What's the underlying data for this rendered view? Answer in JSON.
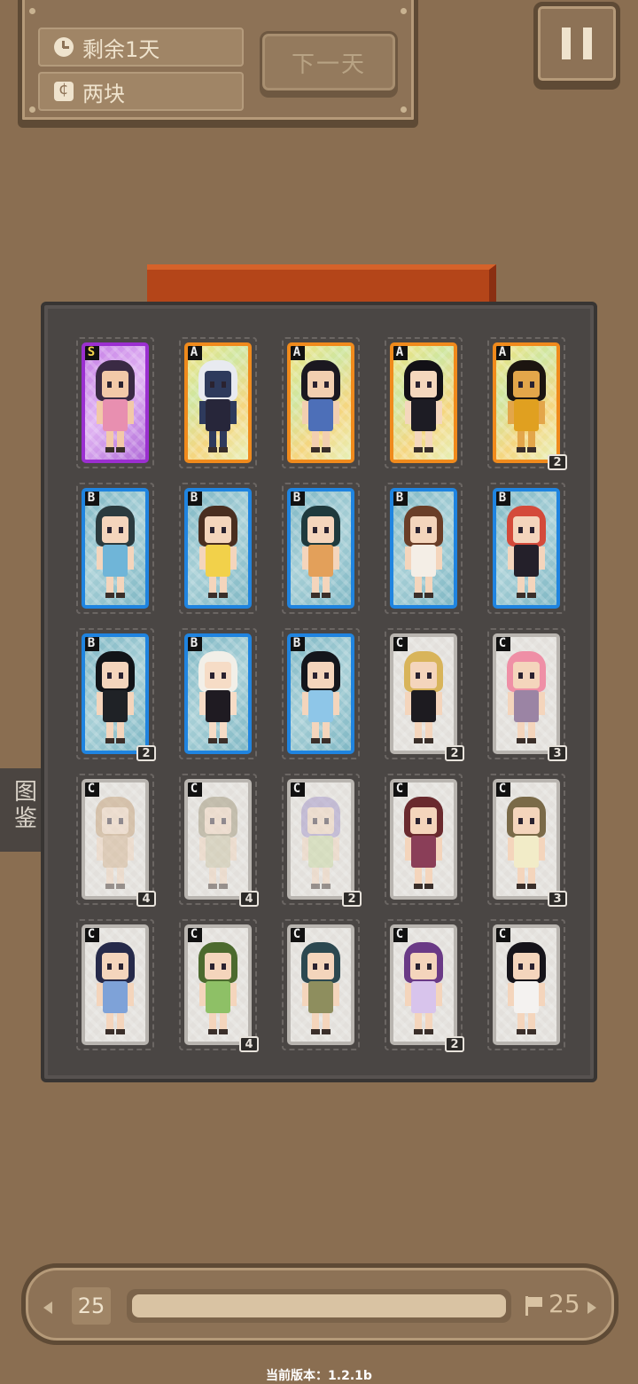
{
  "status": {
    "days_left": "剩余1天",
    "money": "两块",
    "next_day_label": "下一天"
  },
  "side_tab": {
    "label": "图鉴"
  },
  "album": {
    "cards": [
      {
        "rank": "S",
        "count": "",
        "tier": "S",
        "hair": "#3a2a44",
        "cloth": "#e88fb0",
        "skin": "#f2c9a8"
      },
      {
        "rank": "A",
        "count": "",
        "tier": "A",
        "hair": "#e8eaf0",
        "cloth": "#27263a",
        "skin": "#2e3a5c"
      },
      {
        "rank": "A",
        "count": "",
        "tier": "A",
        "hair": "#1b1820",
        "cloth": "#4d6fb8",
        "skin": "#f2cfb0"
      },
      {
        "rank": "A",
        "count": "",
        "tier": "A",
        "hair": "#121016",
        "cloth": "#1d1c24",
        "skin": "#f4d7bd"
      },
      {
        "rank": "A",
        "count": "2",
        "tier": "A",
        "hair": "#1c1510",
        "cloth": "#e0a020",
        "skin": "#e3a64a"
      },
      {
        "rank": "B",
        "count": "",
        "tier": "B",
        "hair": "#2b3b3f",
        "cloth": "#6fb5d8",
        "skin": "#f4d5bc"
      },
      {
        "rank": "B",
        "count": "",
        "tier": "B",
        "hair": "#4a2e20",
        "cloth": "#f2d14a",
        "skin": "#f4d5bc"
      },
      {
        "rank": "B",
        "count": "",
        "tier": "B",
        "hair": "#1f3a3d",
        "cloth": "#e3a05a",
        "skin": "#f4d5bc"
      },
      {
        "rank": "B",
        "count": "",
        "tier": "B",
        "hair": "#6a3e28",
        "cloth": "#f4eee6",
        "skin": "#f4d5bc"
      },
      {
        "rank": "B",
        "count": "",
        "tier": "B",
        "hair": "#d44a3a",
        "cloth": "#24202a",
        "skin": "#f4d5bc"
      },
      {
        "rank": "B",
        "count": "2",
        "tier": "B",
        "hair": "#121418",
        "cloth": "#1f2226",
        "skin": "#f4d5bc"
      },
      {
        "rank": "B",
        "count": "",
        "tier": "B",
        "hair": "#f2efe8",
        "cloth": "#1f1b22",
        "skin": "#f6dcc6"
      },
      {
        "rank": "B",
        "count": "",
        "tier": "B",
        "hair": "#14161c",
        "cloth": "#8ec6e8",
        "skin": "#f4d5bc"
      },
      {
        "rank": "C",
        "count": "2",
        "tier": "C",
        "hair": "#d8b45a",
        "cloth": "#1d1b20",
        "skin": "#f4d5bc"
      },
      {
        "rank": "C",
        "count": "3",
        "tier": "C",
        "hair": "#ef8fa6",
        "cloth": "#9b84a4",
        "skin": "#f4d5bc"
      },
      {
        "rank": "C",
        "count": "4",
        "tier": "C",
        "faded": true,
        "hair": "#c29b6e",
        "cloth": "#d3b08a",
        "skin": "#f4d5bc"
      },
      {
        "rank": "C",
        "count": "4",
        "tier": "C",
        "faded": true,
        "hair": "#9a9070",
        "cloth": "#c9c2a0",
        "skin": "#f4d5bc"
      },
      {
        "rank": "C",
        "count": "2",
        "tier": "C",
        "faded": true,
        "hair": "#9c8ec8",
        "cloth": "#c6d89c",
        "skin": "#f4d5bc"
      },
      {
        "rank": "C",
        "count": "",
        "tier": "C",
        "hair": "#6a2a2e",
        "cloth": "#8a3e58",
        "skin": "#f4d5bc"
      },
      {
        "rank": "C",
        "count": "3",
        "tier": "C",
        "hair": "#7a6a48",
        "cloth": "#f2ecc8",
        "skin": "#f4d5bc"
      },
      {
        "rank": "C",
        "count": "",
        "tier": "C",
        "hair": "#262a4a",
        "cloth": "#7ea2d8",
        "skin": "#f4d5bc"
      },
      {
        "rank": "C",
        "count": "4",
        "tier": "C",
        "hair": "#4c6a2e",
        "cloth": "#8ec066",
        "skin": "#f4d5bc"
      },
      {
        "rank": "C",
        "count": "",
        "tier": "C",
        "hair": "#2c4850",
        "cloth": "#8e8e5e",
        "skin": "#f4d5bc"
      },
      {
        "rank": "C",
        "count": "2",
        "tier": "C",
        "hair": "#6a3a86",
        "cloth": "#d8c4ec",
        "skin": "#f4d5bc"
      },
      {
        "rank": "C",
        "count": "",
        "tier": "C",
        "hair": "#16141a",
        "cloth": "#f4f2f0",
        "skin": "#f4d5bc"
      }
    ]
  },
  "timeline": {
    "current_day": "25",
    "end_day": "25",
    "progress": 1.0
  },
  "version": "当前版本：1.2.1b",
  "colors": {
    "tier_S_frame": "#9b2fd0",
    "tier_A_frame": "#f08a1c",
    "tier_B_frame": "#1f84e0",
    "tier_C_frame": "#b9b5b0"
  }
}
